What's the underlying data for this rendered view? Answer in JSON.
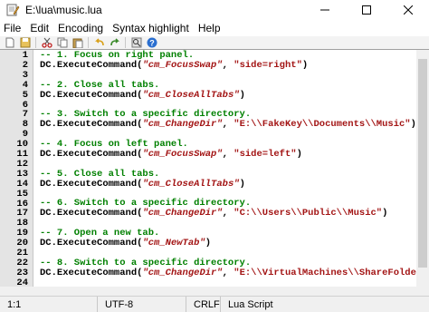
{
  "window": {
    "title": "E:\\lua\\music.lua"
  },
  "menu": [
    "File",
    "Edit",
    "Encoding",
    "Syntax highlight",
    "Help"
  ],
  "toolbar": {
    "buttons": [
      {
        "name": "new-file-icon"
      },
      {
        "name": "save-icon"
      },
      {
        "name": "cut-icon"
      },
      {
        "name": "copy-icon"
      },
      {
        "name": "paste-icon"
      },
      {
        "name": "undo-icon"
      },
      {
        "name": "redo-icon"
      },
      {
        "name": "find-icon"
      },
      {
        "name": "help-icon"
      }
    ]
  },
  "editor": {
    "lines": [
      {
        "n": "1",
        "segments": [
          {
            "t": "-- 1. Focus on right panel.",
            "c": "c-comment"
          }
        ]
      },
      {
        "n": "2",
        "segments": [
          {
            "t": "DC",
            "c": "c-obj"
          },
          {
            "t": ".ExecuteCommand(",
            "c": "c-obj"
          },
          {
            "t": "\"cm_FocusSwap\"",
            "c": "c-str"
          },
          {
            "t": ", ",
            "c": "c-obj"
          },
          {
            "t": "\"side=right\"",
            "c": "c-str"
          },
          {
            "t": ")",
            "c": "c-obj"
          }
        ]
      },
      {
        "n": "3",
        "segments": []
      },
      {
        "n": "4",
        "segments": [
          {
            "t": "-- 2. Close all tabs.",
            "c": "c-comment"
          }
        ]
      },
      {
        "n": "5",
        "segments": [
          {
            "t": "DC",
            "c": "c-obj"
          },
          {
            "t": ".ExecuteCommand(",
            "c": "c-obj"
          },
          {
            "t": "\"cm_CloseAllTabs\"",
            "c": "c-str"
          },
          {
            "t": ")",
            "c": "c-obj"
          }
        ]
      },
      {
        "n": "6",
        "segments": []
      },
      {
        "n": "7",
        "segments": [
          {
            "t": "-- 3. Switch to a specific directory.",
            "c": "c-comment"
          }
        ]
      },
      {
        "n": "8",
        "segments": [
          {
            "t": "DC",
            "c": "c-obj"
          },
          {
            "t": ".ExecuteCommand(",
            "c": "c-obj"
          },
          {
            "t": "\"cm_ChangeDir\"",
            "c": "c-str"
          },
          {
            "t": ", ",
            "c": "c-obj"
          },
          {
            "t": "\"E:\\\\FakeKey\\\\Documents\\\\Music\"",
            "c": "c-str"
          },
          {
            "t": ")",
            "c": "c-obj"
          }
        ]
      },
      {
        "n": "9",
        "segments": []
      },
      {
        "n": "10",
        "segments": [
          {
            "t": "-- 4. Focus on left panel.",
            "c": "c-comment"
          }
        ]
      },
      {
        "n": "11",
        "segments": [
          {
            "t": "DC",
            "c": "c-obj"
          },
          {
            "t": ".ExecuteCommand(",
            "c": "c-obj"
          },
          {
            "t": "\"cm_FocusSwap\"",
            "c": "c-str"
          },
          {
            "t": ", ",
            "c": "c-obj"
          },
          {
            "t": "\"side=left\"",
            "c": "c-str"
          },
          {
            "t": ")",
            "c": "c-obj"
          }
        ]
      },
      {
        "n": "12",
        "segments": []
      },
      {
        "n": "13",
        "segments": [
          {
            "t": "-- 5. Close all tabs.",
            "c": "c-comment"
          }
        ]
      },
      {
        "n": "14",
        "segments": [
          {
            "t": "DC",
            "c": "c-obj"
          },
          {
            "t": ".ExecuteCommand(",
            "c": "c-obj"
          },
          {
            "t": "\"cm_CloseAllTabs\"",
            "c": "c-str"
          },
          {
            "t": ")",
            "c": "c-obj"
          }
        ]
      },
      {
        "n": "15",
        "segments": []
      },
      {
        "n": "16",
        "segments": [
          {
            "t": "-- 6. Switch to a specific directory.",
            "c": "c-comment"
          }
        ]
      },
      {
        "n": "17",
        "segments": [
          {
            "t": "DC",
            "c": "c-obj"
          },
          {
            "t": ".ExecuteCommand(",
            "c": "c-obj"
          },
          {
            "t": "\"cm_ChangeDir\"",
            "c": "c-str"
          },
          {
            "t": ", ",
            "c": "c-obj"
          },
          {
            "t": "\"C:\\\\Users\\\\Public\\\\Music\"",
            "c": "c-str"
          },
          {
            "t": ")",
            "c": "c-obj"
          }
        ]
      },
      {
        "n": "18",
        "segments": []
      },
      {
        "n": "19",
        "segments": [
          {
            "t": "-- 7. Open a new tab.",
            "c": "c-comment"
          }
        ]
      },
      {
        "n": "20",
        "segments": [
          {
            "t": "DC",
            "c": "c-obj"
          },
          {
            "t": ".ExecuteCommand(",
            "c": "c-obj"
          },
          {
            "t": "\"cm_NewTab\"",
            "c": "c-str"
          },
          {
            "t": ")",
            "c": "c-obj"
          }
        ]
      },
      {
        "n": "21",
        "segments": []
      },
      {
        "n": "22",
        "segments": [
          {
            "t": "-- 8. Switch to a specific directory.",
            "c": "c-comment"
          }
        ]
      },
      {
        "n": "23",
        "segments": [
          {
            "t": "DC",
            "c": "c-obj"
          },
          {
            "t": ".ExecuteCommand(",
            "c": "c-obj"
          },
          {
            "t": "\"cm_ChangeDir\"",
            "c": "c-str"
          },
          {
            "t": ", ",
            "c": "c-obj"
          },
          {
            "t": "\"E:\\\\VirtualMachines\\\\ShareFolder\"",
            "c": "c-str"
          },
          {
            "t": ")",
            "c": "c-obj"
          }
        ]
      },
      {
        "n": "24",
        "segments": []
      }
    ]
  },
  "status": {
    "position": "1:1",
    "encoding": "UTF-8",
    "line_ending": "CRLF",
    "syntax": "Lua Script"
  },
  "colors": {
    "comment": "#008000",
    "string": "#a31515",
    "gutter": "#e4e4e4"
  }
}
